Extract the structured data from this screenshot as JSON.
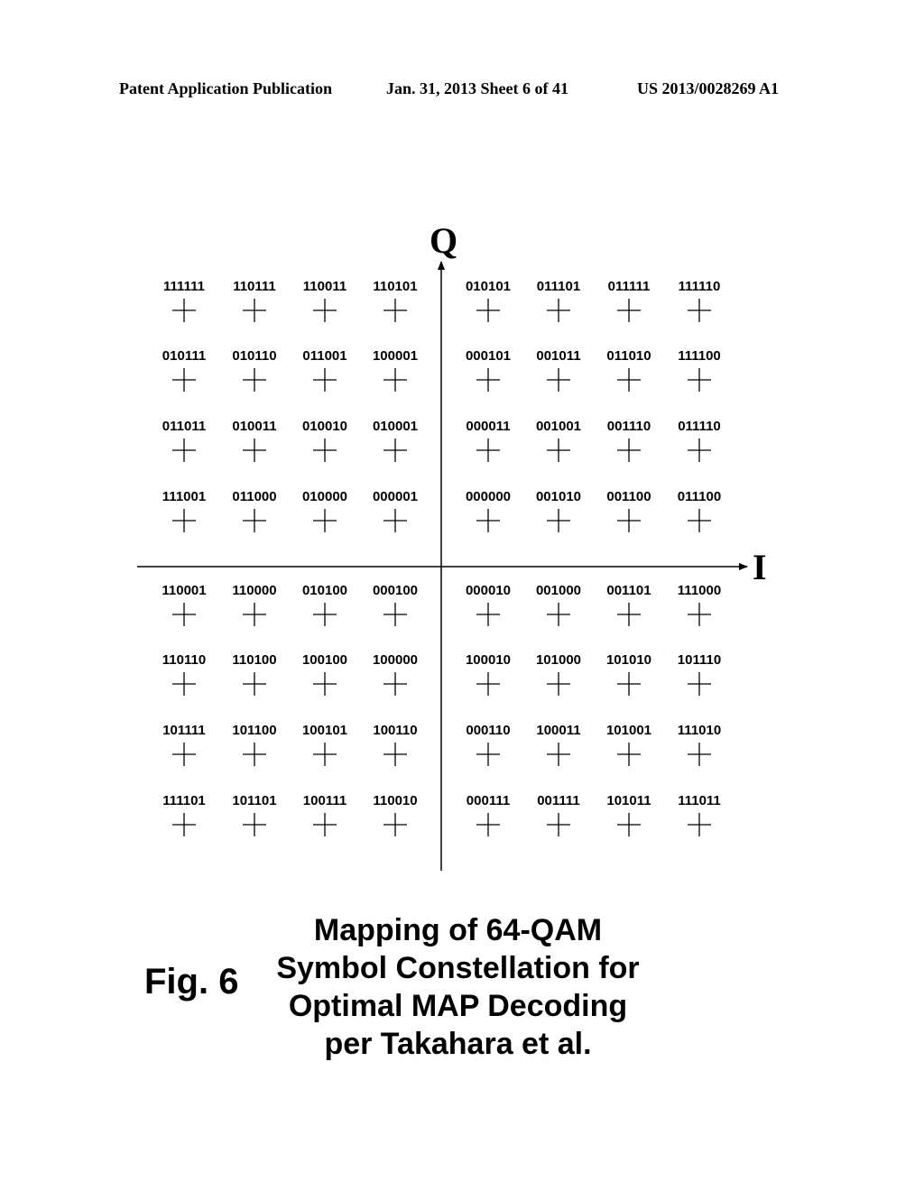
{
  "header": {
    "publication": "Patent Application Publication",
    "date_sheet": "Jan. 31, 2013  Sheet 6 of 41",
    "number": "US 2013/0028269 A1"
  },
  "figure": {
    "number": "Fig. 6",
    "caption_lines": [
      "Mapping of 64-QAM",
      "Symbol Constellation for",
      "Optimal MAP Decoding",
      "per Takahara et al."
    ]
  },
  "constellation": {
    "axis_q_label": "Q",
    "axis_i_label": "I",
    "marker": "plus",
    "rows": [
      [
        "111111",
        "110111",
        "110011",
        "110101",
        "010101",
        "011101",
        "011111",
        "111110"
      ],
      [
        "010111",
        "010110",
        "011001",
        "100001",
        "000101",
        "001011",
        "011010",
        "111100"
      ],
      [
        "011011",
        "010011",
        "010010",
        "010001",
        "000011",
        "001001",
        "001110",
        "011110"
      ],
      [
        "111001",
        "011000",
        "010000",
        "000001",
        "000000",
        "001010",
        "001100",
        "011100"
      ],
      [
        "110001",
        "110000",
        "010100",
        "000100",
        "000010",
        "001000",
        "001101",
        "111000"
      ],
      [
        "110110",
        "110100",
        "100100",
        "100000",
        "100010",
        "101000",
        "101010",
        "101110"
      ],
      [
        "101111",
        "101100",
        "100101",
        "100110",
        "000110",
        "100011",
        "101001",
        "111010"
      ],
      [
        "111101",
        "101101",
        "100111",
        "110010",
        "000111",
        "001111",
        "101011",
        "111011"
      ]
    ]
  }
}
